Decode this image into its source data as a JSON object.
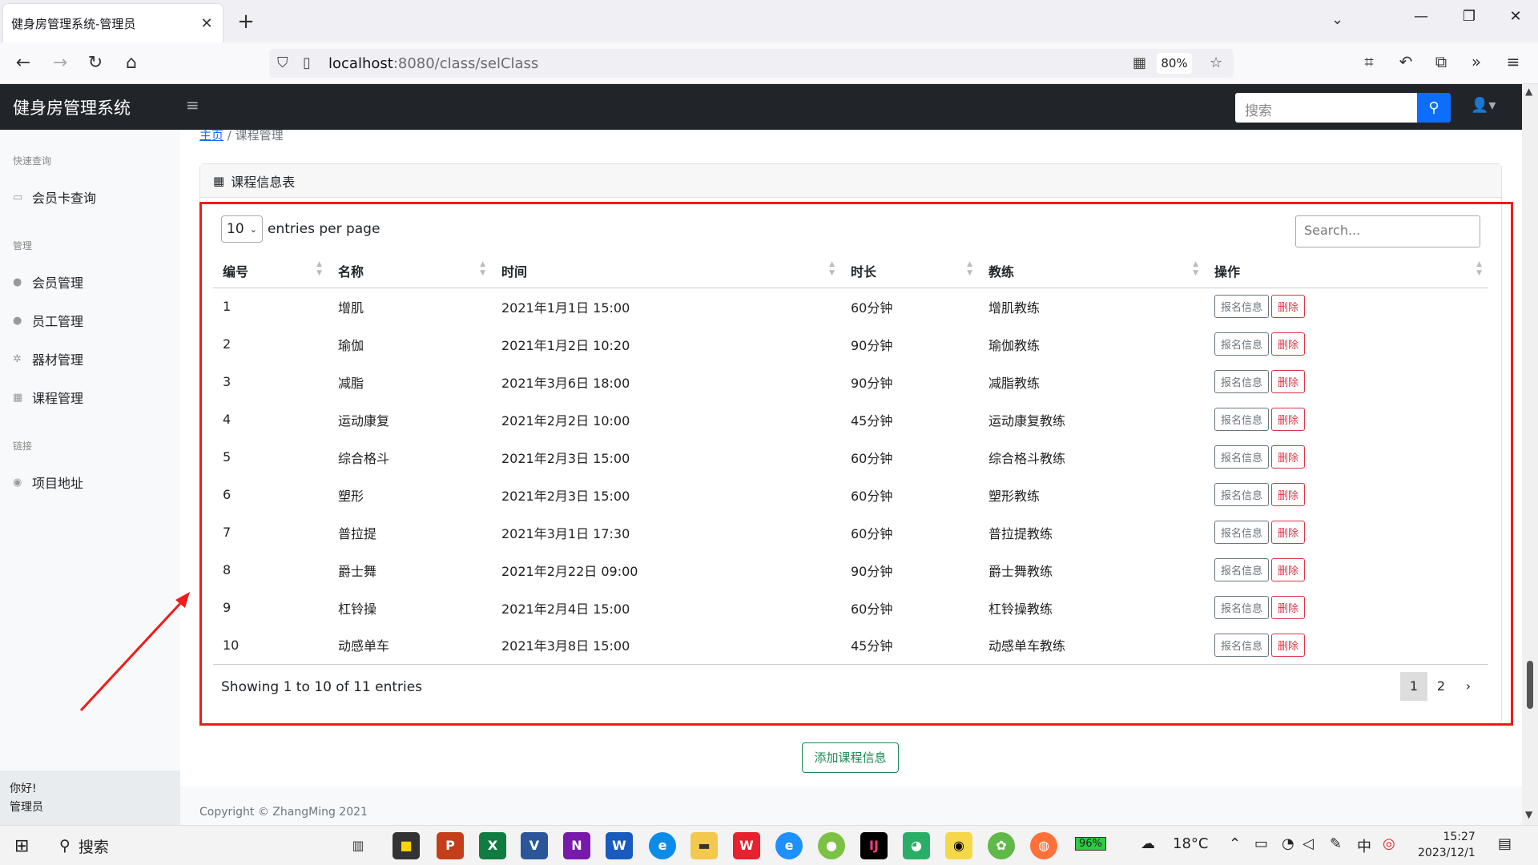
{
  "browser": {
    "tab_title": "健身房管理系统-管理员",
    "url_host": "localhost",
    "url_path": ":8080/class/selClass",
    "zoom": "80%"
  },
  "app": {
    "brand": "健身房管理系统",
    "search_placeholder": "搜索"
  },
  "sidebar": {
    "sections": [
      {
        "heading": "快速查询",
        "items": [
          {
            "label": "会员卡查询",
            "icon": "card-icon"
          }
        ]
      },
      {
        "heading": "管理",
        "items": [
          {
            "label": "会员管理",
            "icon": "user-icon"
          },
          {
            "label": "员工管理",
            "icon": "users-icon"
          },
          {
            "label": "器材管理",
            "icon": "gear-icon"
          },
          {
            "label": "课程管理",
            "icon": "calendar-icon"
          }
        ]
      },
      {
        "heading": "链接",
        "items": [
          {
            "label": "项目地址",
            "icon": "github-icon"
          }
        ]
      }
    ],
    "footer_greeting": "你好!",
    "footer_role": "管理员"
  },
  "breadcrumb": {
    "home": "主页",
    "current": "课程管理"
  },
  "card": {
    "title": "课程信息表"
  },
  "datatable": {
    "page_size": "10",
    "entries_label": "entries per page",
    "search_placeholder": "Search...",
    "columns": [
      "编号",
      "名称",
      "时间",
      "时长",
      "教练",
      "操作"
    ],
    "rows": [
      [
        "1",
        "增肌",
        "2021年1月1日 15:00",
        "60分钟",
        "增肌教练"
      ],
      [
        "2",
        "瑜伽",
        "2021年1月2日 10:20",
        "90分钟",
        "瑜伽教练"
      ],
      [
        "3",
        "减脂",
        "2021年3月6日 18:00",
        "90分钟",
        "减脂教练"
      ],
      [
        "4",
        "运动康复",
        "2021年2月2日 10:00",
        "45分钟",
        "运动康复教练"
      ],
      [
        "5",
        "综合格斗",
        "2021年2月3日 15:00",
        "60分钟",
        "综合格斗教练"
      ],
      [
        "6",
        "塑形",
        "2021年2月3日 15:00",
        "60分钟",
        "塑形教练"
      ],
      [
        "7",
        "普拉提",
        "2021年3月1日 17:30",
        "60分钟",
        "普拉提教练"
      ],
      [
        "8",
        "爵士舞",
        "2021年2月22日 09:00",
        "90分钟",
        "爵士舞教练"
      ],
      [
        "9",
        "杠铃操",
        "2021年2月4日 15:00",
        "60分钟",
        "杠铃操教练"
      ],
      [
        "10",
        "动感单车",
        "2021年3月8日 15:00",
        "45分钟",
        "动感单车教练"
      ]
    ],
    "action_signup": "报名信息",
    "action_delete": "删除",
    "info": "Showing 1 to 10 of 11 entries",
    "pages": [
      "1",
      "2",
      "›"
    ]
  },
  "add_button": "添加课程信息",
  "footer": "Copyright © ZhangMing 2021",
  "taskbar": {
    "search": "搜索",
    "battery": "96%",
    "weather": "18°C",
    "ime": "中",
    "time": "15:27",
    "date": "2023/12/1"
  }
}
